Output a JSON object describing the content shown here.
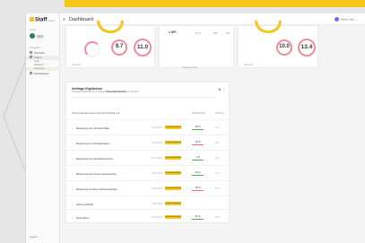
{
  "app": {
    "logo": "Staff",
    "logo_suffix": "Cone",
    "page_title": "Dashboard"
  },
  "sidebar": {
    "section_account": "Konto",
    "user_name": "Jakob",
    "user_role": "Admin",
    "section_nav": "Navigation",
    "items": [
      {
        "label": "Übersicht",
        "active": false
      },
      {
        "label": "Teams",
        "active": true
      },
      {
        "label": "Einstellungen",
        "active": false
      }
    ],
    "subitems": [
      "Team",
      "Mitglieder",
      "Kategorien"
    ],
    "logout_label": "Logout"
  },
  "topbar": {
    "user_label": "Admin User"
  },
  "metrics_left": {
    "caption": "Zeitraum",
    "gauges": [
      {
        "value": "9.7"
      },
      {
        "value": "11.0"
      }
    ]
  },
  "metrics_mid": {
    "title": "KPI",
    "stats": [
      {
        "value": "10.0",
        "color": "red"
      },
      {
        "value": "9.5",
        "color": "default"
      },
      {
        "value": "8.5",
        "color": "green"
      }
    ],
    "caption": "Vergleichswerte"
  },
  "metrics_right": {
    "caption": "Zeitraum",
    "gauges": [
      {
        "value": "10.0"
      },
      {
        "value": "13.4"
      }
    ]
  },
  "list": {
    "title": "Umfrage-Ergebnisse",
    "subtitle_prefix": "Durchschnittswerte der Umfrage",
    "subtitle_bold": "Teamzufriedenheit",
    "subtitle_suffix": "im Zeitraum",
    "actions": "⚙ ⋮",
    "header_left": "Themengebiete sortiert nach Durchschnitt ▲▼",
    "header_col1": "Durchschnitt",
    "header_col2": "Vorherig",
    "rows": [
      {
        "label": "Bewertung der Arbeitsinhalte",
        "date": "13.03.2023",
        "badge": "Teamzufriedenheit",
        "score": "10.0",
        "bar_color": "#4caf50",
        "prev": "9.5"
      },
      {
        "label": "Bewertung der Arbeitsplatzes",
        "date": "13.03.2023",
        "badge": "Teamzufriedenheit",
        "score": "10.5",
        "bar_color": "#f06292",
        "prev": "9.8"
      },
      {
        "label": "Bewertung der Arbeitsbereiches",
        "date": "13.03.2023",
        "badge": "Teamzufriedenheit",
        "score": "7.3",
        "bar_color": "#4caf50",
        "prev": "6.9"
      },
      {
        "label": "Bewertung des Team-Vorgesetzten",
        "date": "13.03.2023",
        "badge": "Teamzufriedenheit",
        "score": "12.4",
        "bar_color": "#4caf50",
        "prev": "11.2"
      },
      {
        "label": "Bewertung der/des Arbeitsumfeldes",
        "date": "13.03.2023",
        "badge": "Teamzufriedenheit",
        "score": "12.0",
        "bar_color": "#f06292",
        "prev": "11.5"
      },
      {
        "label": "Wertung/Detail",
        "date": "13.03.2023",
        "badge": "Teamzufriedenheit",
        "score": "",
        "bar_color": "#ffffff",
        "prev": ""
      },
      {
        "label": "Datenlisten",
        "date": "13.03.2023",
        "badge": "Teamzufriedenheit",
        "score": "10.2",
        "bar_color": "#4caf50",
        "prev": "10.0"
      }
    ]
  },
  "colors": {
    "accent": "#f5c518",
    "gauge": "#f28b9d"
  }
}
